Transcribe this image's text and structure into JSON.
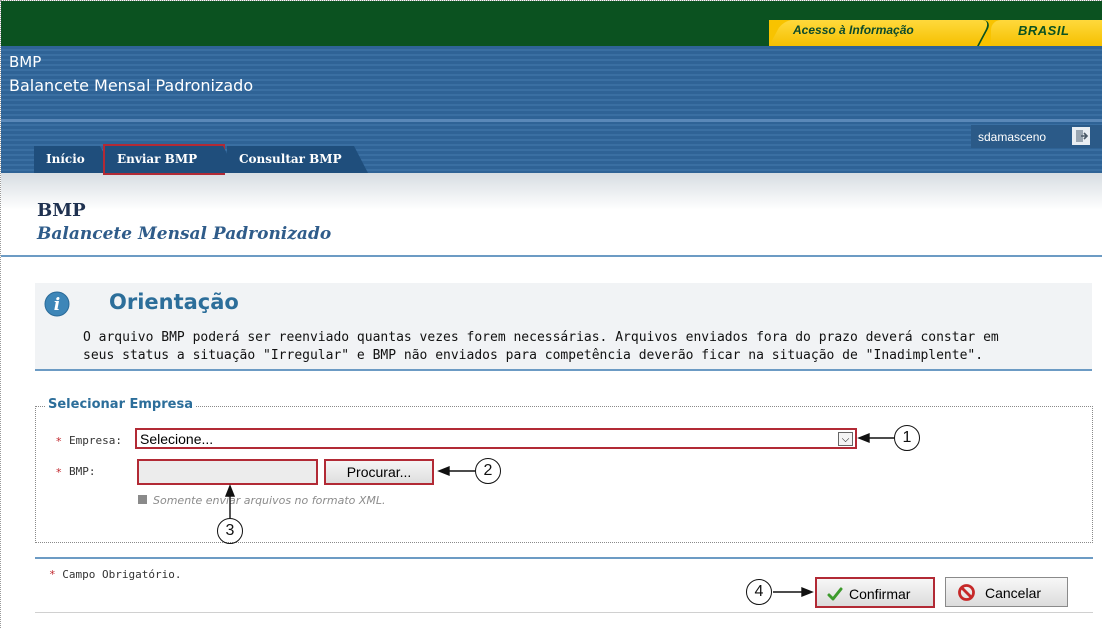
{
  "gov_bar": {
    "acesso": "Acesso à Informação",
    "brasil": "BRASIL"
  },
  "header": {
    "app_short": "BMP",
    "app_long": "Balancete Mensal Padronizado",
    "username": "sdamasceno"
  },
  "tabs": [
    {
      "label": "Início"
    },
    {
      "label": "Enviar BMP"
    },
    {
      "label": "Consultar BMP"
    }
  ],
  "page": {
    "title": "BMP",
    "subtitle": "Balancete Mensal Padronizado"
  },
  "orientation": {
    "title": "Orientação",
    "line1": "O arquivo BMP poderá ser reenviado quantas vezes forem necessárias. Arquivos enviados fora do prazo deverá constar em",
    "line2": "seus status a situação \"Irregular\" e BMP não enviados para competência deverão ficar na situação de \"Inadimplente\"."
  },
  "form": {
    "legend": "Selecionar Empresa",
    "required_mark": "*",
    "empresa_label": "Empresa:",
    "empresa_value": "Selecione...",
    "bmp_label": "BMP:",
    "browse_label": "Procurar...",
    "hint": "Somente enviar arquivos no formato XML."
  },
  "footer": {
    "required_note": "Campo Obrigatório.",
    "confirm_label": "Confirmar",
    "cancel_label": "Cancelar"
  },
  "callouts": [
    "1",
    "2",
    "3",
    "4"
  ],
  "icons": {
    "info": "info-icon",
    "logout": "logout-icon",
    "confirm": "check-icon",
    "cancel": "cancel-icon",
    "hint": "hint-icon"
  },
  "colors": {
    "gov_green": "#0b5220",
    "gov_yellow": "#f8c300",
    "banner_blue": "#2f6396",
    "tab_blue": "#1f4e7c",
    "highlight_red": "#b22a35",
    "accent_teal": "#2c6e9a"
  }
}
